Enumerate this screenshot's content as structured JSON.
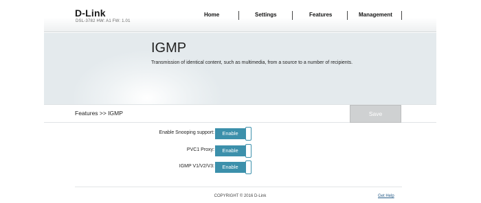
{
  "brand": {
    "logo": "D-Link",
    "model_info": "DSL-3782   HW: A1   FW: 1.01"
  },
  "nav": {
    "items": [
      {
        "label": "Home"
      },
      {
        "label": "Settings"
      },
      {
        "label": "Features"
      },
      {
        "label": "Management"
      }
    ]
  },
  "banner": {
    "title": "IGMP",
    "description": "Transmission of identical content, such as multimedia, from a source to a number of recipients."
  },
  "breadcrumb": {
    "text": "Features >> IGMP"
  },
  "toolbar": {
    "save_label": "Save"
  },
  "settings": [
    {
      "label": "Enable Snooping support:",
      "value": "Enable"
    },
    {
      "label": "PVC1 Proxy:",
      "value": "Enable"
    },
    {
      "label": "IGMP V1/V2/V3:",
      "value": "Enable"
    }
  ],
  "footer": {
    "copyright": "COPYRIGHT © 2016 D-Link",
    "help_link": "Get Help"
  },
  "colors": {
    "accent": "#3c90ab",
    "save_disabled": "#cfd1d2"
  }
}
